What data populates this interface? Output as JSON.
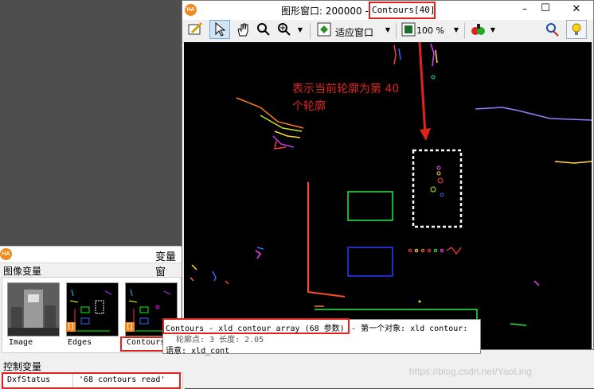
{
  "graphics_window": {
    "logo": "HA",
    "title_prefix": "图形窗口: 200000 -",
    "title_highlight": "Contours[40]",
    "controls": {
      "minimize": "–",
      "maximize": "☐",
      "close": "✕"
    },
    "toolbar": {
      "fit_label": "适应窗口",
      "zoom_value": "100 %"
    },
    "annotation_line1": "表示当前轮廓为第 40",
    "annotation_line2": "个轮廓"
  },
  "variable_window": {
    "logo": "HA",
    "title": "变量窗",
    "iconic_section_label": "图像变量",
    "thumbnails": [
      {
        "caption": "Image"
      },
      {
        "caption": "Edges"
      },
      {
        "caption": "Contours"
      }
    ],
    "control_section_label": "控制变量",
    "control_vars": [
      {
        "name": "DxfStatus",
        "value": "'68 contours read'"
      }
    ]
  },
  "tooltip": {
    "line1_highlight": "Contours - xld contour array (68 参数)",
    "line1_rest": "- 第一个对象: xld contour:",
    "line2": "轮廓点: 3  长度: 2.05",
    "line3": "语意: xld_cont"
  },
  "watermark": "https://blog.csdn.net/YaoLing",
  "colors": {
    "annotation_red": "#e0241b",
    "halcon_orange": "#f28b1e",
    "canvas_bg": "#000000"
  }
}
